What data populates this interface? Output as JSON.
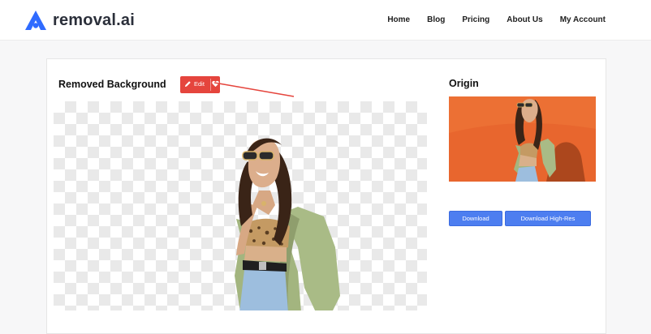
{
  "brand": {
    "name": "removal.ai",
    "accent": "#2f6bff"
  },
  "nav": {
    "items": [
      "Home",
      "Blog",
      "Pricing",
      "About Us",
      "My Account"
    ]
  },
  "result": {
    "title": "Removed Background",
    "edit_label": "Edit",
    "edit_color": "#e5453d"
  },
  "origin": {
    "title": "Origin"
  },
  "actions": {
    "download_label": "Download",
    "download_highres_label": "Download High-Res",
    "button_color": "#4d7ef0"
  }
}
